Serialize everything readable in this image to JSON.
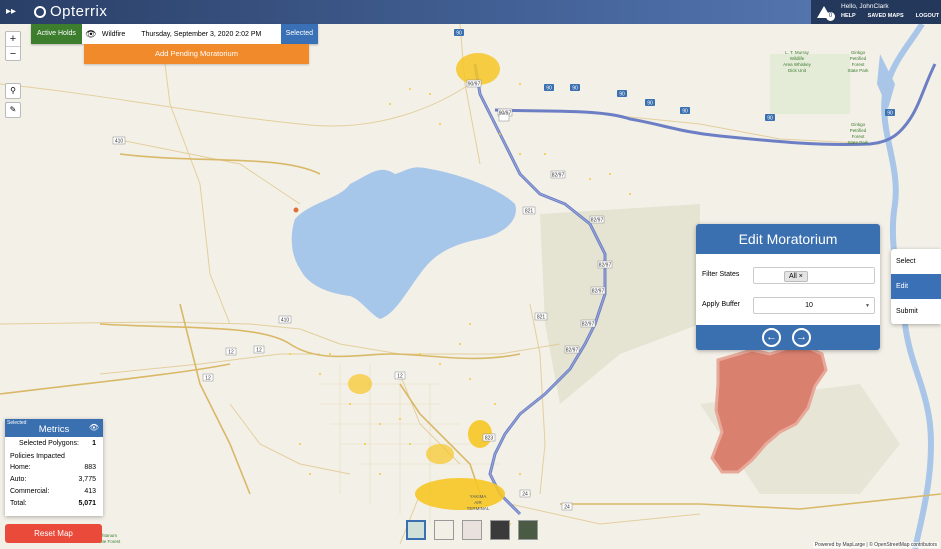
{
  "header": {
    "app_name": "Opterrix",
    "greeting": "Hello, JohnClark",
    "notification_count": "0",
    "links": [
      "HELP",
      "SAVED MAPS",
      "LOGOUT"
    ]
  },
  "holds_bar": {
    "active_holds_label": "Active Holds",
    "event_type": "Wildfire",
    "date": "Thursday, September 3, 2020 2:02 PM",
    "selected_label": "Selected",
    "add_pending_label": "Add Pending Moratorium"
  },
  "map_controls": {
    "zoom_in": "+",
    "zoom_out": "−"
  },
  "edit_panel": {
    "title": "Edit Moratorium",
    "filter_states_label": "Filter States",
    "filter_chip": "All",
    "filter_chip_remove": "×",
    "apply_buffer_label": "Apply Buffer",
    "apply_buffer_value": "10"
  },
  "workflow": {
    "items": [
      "Select",
      "Edit",
      "Submit"
    ],
    "active_index": 1
  },
  "metrics": {
    "selected_tag": "Selected",
    "title": "Metrics",
    "selected_polygons_label": "Selected Polygons:",
    "selected_polygons_value": "1",
    "policies_heading": "Policies Impacted",
    "rows": [
      {
        "label": "Home:",
        "value": "883"
      },
      {
        "label": "Auto:",
        "value": "3,775"
      },
      {
        "label": "Commercial:",
        "value": "413"
      },
      {
        "label": "Total:",
        "value": "5,071"
      }
    ]
  },
  "reset_label": "Reset Map",
  "map_labels": {
    "routes": [
      "90",
      "90/97",
      "90",
      "90",
      "90",
      "90",
      "410",
      "821",
      "82/97",
      "82/97",
      "82/97",
      "821",
      "82/97",
      "410",
      "12",
      "12",
      "12",
      "823",
      "12",
      "24",
      "24"
    ],
    "places": [
      "L. T. Murray Wildlife Area Whiskey Dick Unit",
      "Ginkgo Petrified Forest State Park",
      "Ginkgo Petrified Forest State Park",
      "YAKIMA AIR TERMINAL",
      "Oak Creek Wildlife Area",
      "Wenas Wildlife Area",
      "Ahtanum State Forest"
    ]
  },
  "attribution": "Powered by MapLarge | © OpenStreetMap contributors",
  "colors": {
    "header": "#2a3f66",
    "accent_blue": "#3a6fb0",
    "active_holds_green": "#3c7d2e",
    "orange": "#f08a2a",
    "reset_red": "#e94a3a",
    "fire_polygon": "#9fc2ea",
    "hold_polygon": "#d9806f",
    "policy_points": "#f6c624"
  }
}
